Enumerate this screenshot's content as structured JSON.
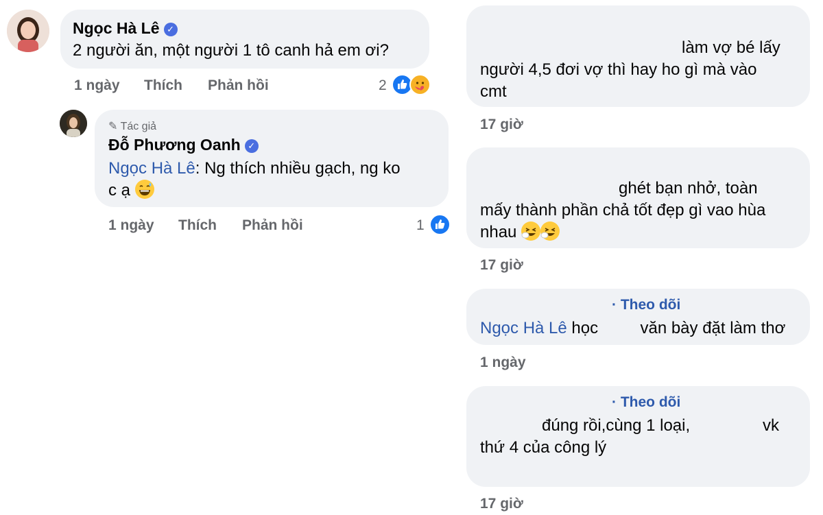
{
  "left": {
    "comment1": {
      "author": "Ngọc Hà Lê",
      "text": "2 người ăn, một người 1 tô canh hả em ơi?",
      "time": "1 ngày",
      "like": "Thích",
      "reply": "Phản hồi",
      "reaction_count": "2"
    },
    "reply1": {
      "badge": "Tác giả",
      "author": "Đỗ Phương Oanh",
      "mention": "Ngọc Hà Lê",
      "text_line1": ": Ng thích nhiều gạch, ng ko",
      "text_line2": "c ạ",
      "time": "1 ngày",
      "like": "Thích",
      "reply": "Phản hồi",
      "reaction_count": "1"
    }
  },
  "right": {
    "c1": {
      "line1": "làm vợ bé lấy",
      "line2": "người 4,5 đơi vợ thì hay ho gì mà vào",
      "line3": "cmt",
      "time": "17 giờ"
    },
    "c2": {
      "line1": "ghét bạn nhở, toàn",
      "line2": "mấy thành phần chả tốt đẹp gì vao hùa",
      "line3": "nhau",
      "time": "17 giờ"
    },
    "c3": {
      "follow": "· Theo dõi",
      "mention": "Ngọc Hà Lê",
      "part1": "học",
      "part2": "văn bày đặt làm thơ",
      "time": "1 ngày"
    },
    "c4": {
      "follow": "· Theo dõi",
      "part1": "đúng rồi,cùng 1 loại,",
      "part2": "vk",
      "line2": "thứ 4 của công lý",
      "time": "17 giờ"
    }
  },
  "icons": {
    "verified": "✓",
    "like": "👍",
    "pencil": "✎"
  },
  "colors": {
    "bubble": "#f0f2f5",
    "mention": "#2e5aac",
    "meta": "#65676b",
    "like": "#1877f2",
    "verified": "#4a6ee0"
  }
}
